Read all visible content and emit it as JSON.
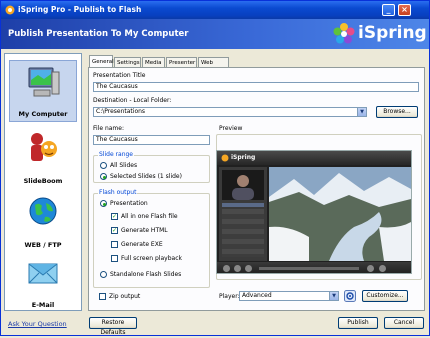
{
  "window": {
    "title": "iSpring Pro - Publish to Flash"
  },
  "header": {
    "title": "Publish Presentation To My Computer",
    "logo_text": "iSpring"
  },
  "sidebar": {
    "items": [
      {
        "label": "My Computer",
        "icon": "computer-icon"
      },
      {
        "label": "SlideBoom",
        "icon": "slideboom-icon"
      },
      {
        "label": "WEB / FTP",
        "icon": "globe-icon"
      },
      {
        "label": "E-Mail",
        "icon": "envelope-icon"
      }
    ],
    "help_link": "Ask Your Question"
  },
  "tabs": [
    "General",
    "Settings",
    "Media",
    "Presenter",
    "Web Links"
  ],
  "general": {
    "presentation_title_label": "Presentation Title",
    "presentation_title_value": "The Caucasus",
    "destination_label": "Destination - Local Folder:",
    "destination_value": "C:\\Presentations",
    "browse_label": "Browse...",
    "file_name_label": "File name:",
    "file_name_value": "The Caucasus",
    "slide_range": {
      "title": "Slide range",
      "all_slides": "All Slides",
      "selected_slides": "Selected Slides (1 slide)"
    },
    "flash_output": {
      "title": "Flash output",
      "presentation": "Presentation",
      "all_in_one": "All in one Flash file",
      "generate_html": "Generate HTML",
      "generate_exe": "Generate EXE",
      "full_screen": "Full screen playback",
      "standalone": "Standalone Flash Slides"
    },
    "zip_output": "Zip output",
    "preview_label": "Preview",
    "player_label": "Player:",
    "player_value": "Advanced",
    "customize_label": "Customize..."
  },
  "preview_player": {
    "logo_text": "iSpring"
  },
  "buttons": {
    "restore_defaults": "Restore Defaults",
    "publish": "Publish",
    "cancel": "Cancel"
  },
  "colors": {
    "header_start": "#1e3fa8",
    "header_end": "#4e86e8",
    "accent_green": "#21a121",
    "group_title": "#0046d5"
  }
}
